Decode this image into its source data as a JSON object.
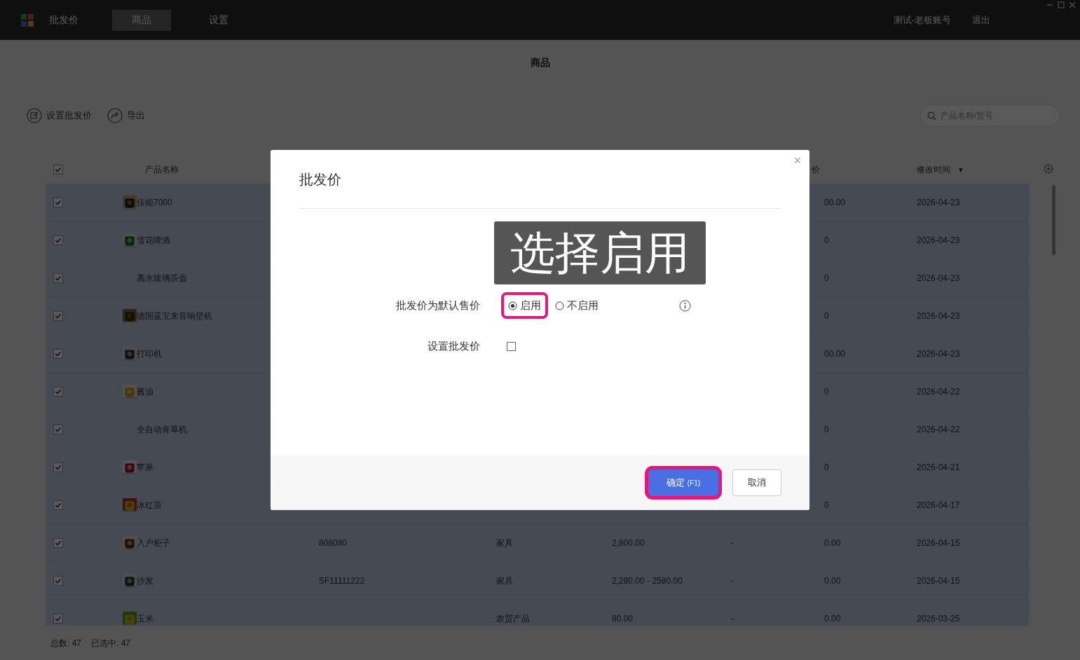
{
  "app": {
    "title": "批发价",
    "nav": [
      {
        "label": "商品",
        "selected": true
      },
      {
        "label": "设置",
        "selected": false
      }
    ],
    "user": "测试-老板账号",
    "logout": "退出"
  },
  "page": {
    "title": "商品",
    "actions": [
      {
        "label": "设置批发价"
      },
      {
        "label": "导出"
      }
    ],
    "search": {
      "placeholder": "产品名称/货号"
    }
  },
  "table": {
    "header_checked": true,
    "header": {
      "name": "产品名称",
      "column_8": "价",
      "modified": "修改时间",
      "sort_mark": "▼"
    },
    "rows": [
      {
        "checked": true,
        "image": true,
        "name": "佳能7000",
        "column_8": "00.00",
        "modified": "2026-04-23"
      },
      {
        "checked": true,
        "image": true,
        "name": "雪花啤酒",
        "column_8": "0",
        "modified": "2026-04-23"
      },
      {
        "checked": true,
        "image": false,
        "name": "高水玻璃茶壶",
        "column_8": "0",
        "modified": "2026-04-23"
      },
      {
        "checked": true,
        "image": true,
        "name": "德国蓝宝来音响壁机",
        "column_8": "0",
        "modified": "2026-04-23"
      },
      {
        "checked": true,
        "image": true,
        "name": "打印机",
        "column_8": "00.00",
        "modified": "2026-04-23"
      },
      {
        "checked": true,
        "image": true,
        "name": "酱油",
        "column_8": "0",
        "modified": "2026-04-22"
      },
      {
        "checked": true,
        "image": false,
        "name": "全自动青草机",
        "column_8": "0",
        "modified": "2026-04-22"
      },
      {
        "checked": true,
        "image": true,
        "name": "苹果",
        "column_8": "0",
        "modified": "2026-04-21"
      },
      {
        "checked": true,
        "image": true,
        "name": "冰红茶",
        "column_8": "0",
        "modified": "2026-04-17"
      },
      {
        "checked": true,
        "image": true,
        "name": "入户柜子",
        "code": "808080",
        "category": "家具",
        "price": "2,800.00",
        "column_7": "-",
        "column_8": "0.00",
        "modified": "2026-04-15"
      },
      {
        "checked": true,
        "image": true,
        "name": "沙发",
        "code": "SF11111222",
        "category": "家具",
        "price": "2,280.00 - 2580.00",
        "column_7": "-",
        "column_8": "0.00",
        "modified": "2026-04-15"
      },
      {
        "checked": true,
        "image": true,
        "name": "玉米",
        "category": "农贸产品",
        "price": "80.00",
        "column_7": "-",
        "column_8": "0.00",
        "modified": "2026-03-25"
      }
    ]
  },
  "footer": {
    "total_label": "总数:",
    "total": "47",
    "selected_label": "已选中:",
    "selected_count": "47"
  },
  "dialog": {
    "title": "批发价",
    "close": "×",
    "annotation": "选择启用",
    "fields": [
      {
        "kind": "radio",
        "label": "批发价为默认售价",
        "options": [
          {
            "label": "启用",
            "selected": true,
            "highlighted": true
          },
          {
            "label": "不启用",
            "selected": false,
            "highlighted": false
          }
        ]
      },
      {
        "kind": "checkbox",
        "label": "设置批发价",
        "checked": false
      }
    ],
    "buttons": [
      {
        "label": "确定",
        "hint": "(F1)",
        "primary": true,
        "highlighted": true
      },
      {
        "label": "取消",
        "primary": false,
        "highlighted": false
      }
    ]
  }
}
